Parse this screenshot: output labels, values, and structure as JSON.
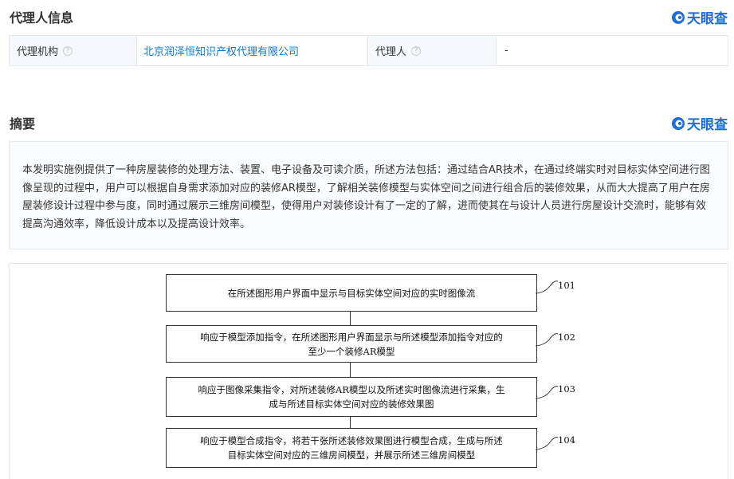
{
  "agent_section": {
    "title": "代理人信息",
    "brand": "天眼查",
    "org_label": "代理机构",
    "org_value": "北京润泽恒知识产权代理有限公司",
    "agent_label": "代理人",
    "agent_value": "-",
    "help_glyph": "?"
  },
  "abstract_section": {
    "title": "摘要",
    "brand": "天眼查",
    "text": "本发明实施例提供了一种房屋装修的处理方法、装置、电子设备及可读介质，所述方法包括：通过结合AR技术，在通过终端实时对目标实体空间进行图像呈现的过程中，用户可以根据自身需求添加对应的装修AR模型，了解相关装修模型与实体空间之间进行组合后的装修效果，从而大大提高了用户在房屋装修设计过程中参与度，同时通过展示三维房间模型，使得用户对装修设计有了一定的了解，进而使其在与设计人员进行房屋设计交流时，能够有效提高沟通效率，降低设计成本以及提高设计效率。"
  },
  "figure": {
    "steps": [
      {
        "number": "101",
        "lines": [
          "在所述图形用户界面中显示与目标实体空间对应的实时图像流"
        ]
      },
      {
        "number": "102",
        "lines": [
          "响应于模型添加指令，在所述图形用户界面显示与所述模型添加指令对应的",
          "至少一个装修AR模型"
        ]
      },
      {
        "number": "103",
        "lines": [
          "响应于图像采集指令，对所述装修AR模型以及所述实时图像流进行采集，生",
          "成与所述目标实体空间对应的装修效果图"
        ]
      },
      {
        "number": "104",
        "lines": [
          "响应于模型合成指令，将若干张所述装修效果图进行模型合成，生成与所述",
          "目标实体空间对应的三维房间模型，并展示所述三维房间模型"
        ]
      }
    ]
  },
  "colors": {
    "brand": "#1a6fd6",
    "link": "#0c7ad6",
    "label_bg": "#f5f8fc",
    "border": "#e6e9ed"
  }
}
